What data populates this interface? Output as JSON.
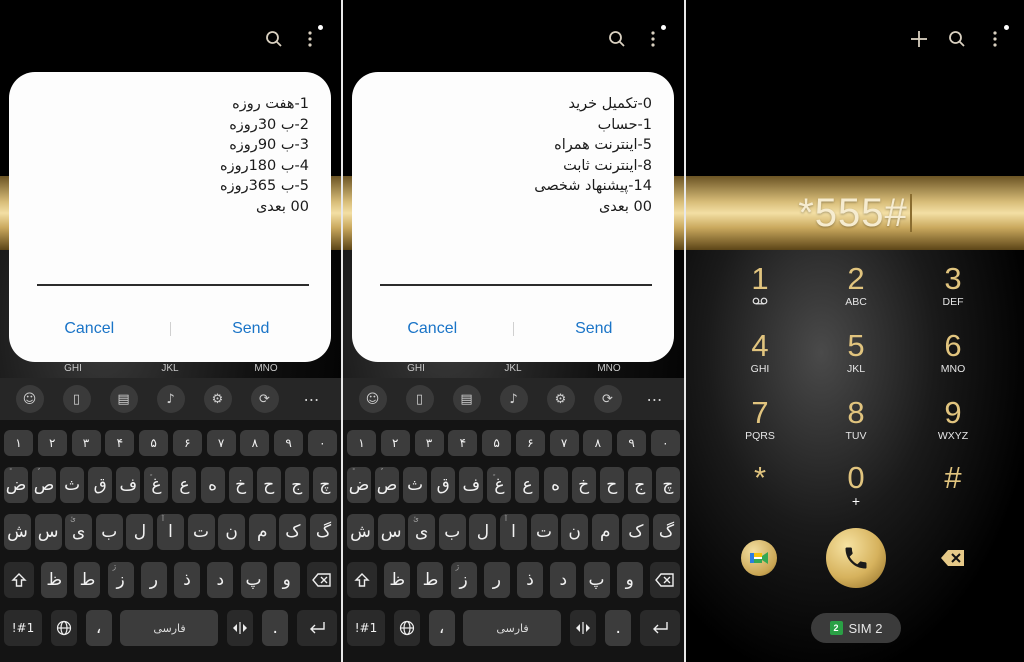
{
  "panel1": {
    "dialog": {
      "lines": [
        "1-هفت روزه",
        "2-ب 30روزه",
        "3-ب 90روزه",
        "4-ب 180روزه",
        "5-ب 365روزه",
        "00 بعدی"
      ],
      "cancel_label": "Cancel",
      "send_label": "Send"
    }
  },
  "panel2": {
    "dialog": {
      "lines": [
        "0-تکمیل خرید",
        "1-حساب",
        "5-اینترنت همراه",
        "8-اینترنت ثابت",
        "14-پیشنهاد شخصی",
        "00 بعدی"
      ],
      "cancel_label": "Cancel",
      "send_label": "Send"
    }
  },
  "peek_labels": [
    "GHI",
    "JKL",
    "MNO"
  ],
  "keyboard": {
    "toolbar_icons": [
      "emoji-icon",
      "clipboard-icon",
      "document-icon",
      "microphone-icon",
      "settings-icon",
      "translate-icon",
      "more-icon"
    ],
    "number_row": [
      "۱",
      "۲",
      "۳",
      "۴",
      "۵",
      "۶",
      "۷",
      "۸",
      "۹",
      "۰"
    ],
    "row1": [
      "ض",
      "ص",
      "ث",
      "ق",
      "ف",
      "غ",
      "ع",
      "ه",
      "خ",
      "ح",
      "ج",
      "چ"
    ],
    "row1_hints": [
      "ً",
      "ٌ",
      "",
      "",
      "",
      "ٍ",
      "",
      "",
      "",
      "",
      "",
      ""
    ],
    "row2": [
      "ش",
      "س",
      "ی",
      "ب",
      "ل",
      "ا",
      "ت",
      "ن",
      "م",
      "ک",
      "گ"
    ],
    "row2_hints": [
      "",
      "",
      "ئ",
      "",
      "",
      "آ",
      "",
      "",
      "",
      "",
      ""
    ],
    "row3": [
      "ظ",
      "ط",
      "ز",
      "ر",
      "ذ",
      "د",
      "پ",
      "و"
    ],
    "row3_hints": [
      "",
      "",
      "ژ",
      "",
      "",
      "",
      "",
      ""
    ],
    "symbols_label": "!#1",
    "comma_label": "،",
    "space_label": "فارسی",
    "period_label": "."
  },
  "dialer": {
    "input_value": "*555#",
    "keys": [
      {
        "digit": "1",
        "sub": "voicemail"
      },
      {
        "digit": "2",
        "sub": "ABC"
      },
      {
        "digit": "3",
        "sub": "DEF"
      },
      {
        "digit": "4",
        "sub": "GHI"
      },
      {
        "digit": "5",
        "sub": "JKL"
      },
      {
        "digit": "6",
        "sub": "MNO"
      },
      {
        "digit": "7",
        "sub": "PQRS"
      },
      {
        "digit": "8",
        "sub": "TUV"
      },
      {
        "digit": "9",
        "sub": "WXYZ"
      },
      {
        "digit": "*",
        "sub": ""
      },
      {
        "digit": "0",
        "sub": "+"
      },
      {
        "digit": "#",
        "sub": ""
      }
    ],
    "sim_number": "2",
    "sim_label": "SIM 2",
    "colors": {
      "gold": "#e1c47e",
      "call_button": "#d6b25d",
      "sim_badge": "#2aa045"
    }
  }
}
